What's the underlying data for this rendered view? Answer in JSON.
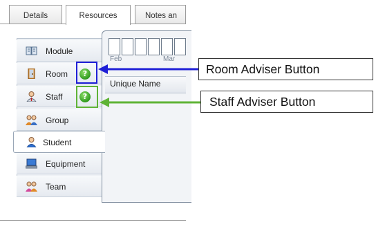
{
  "tabs": [
    {
      "label": "Details"
    },
    {
      "label": "Resources"
    },
    {
      "label": "Notes an"
    }
  ],
  "sidebar": {
    "items": [
      {
        "label": "Module",
        "icon": "module-icon"
      },
      {
        "label": "Room",
        "icon": "room-icon"
      },
      {
        "label": "Staff",
        "icon": "staff-icon"
      },
      {
        "label": "Group",
        "icon": "group-icon"
      },
      {
        "label": "Student",
        "icon": "student-icon"
      },
      {
        "label": "Equipment",
        "icon": "equipment-icon"
      },
      {
        "label": "Team",
        "icon": "team-icon"
      }
    ],
    "adviser_symbol": "?"
  },
  "timeline": {
    "months": [
      "Feb",
      "Mar"
    ],
    "column_header": "Unique Name"
  },
  "callouts": {
    "room": "Room Adviser Button",
    "staff": "Staff Adviser Button",
    "room_color": "#1f1fd6",
    "staff_color": "#5fb336"
  }
}
